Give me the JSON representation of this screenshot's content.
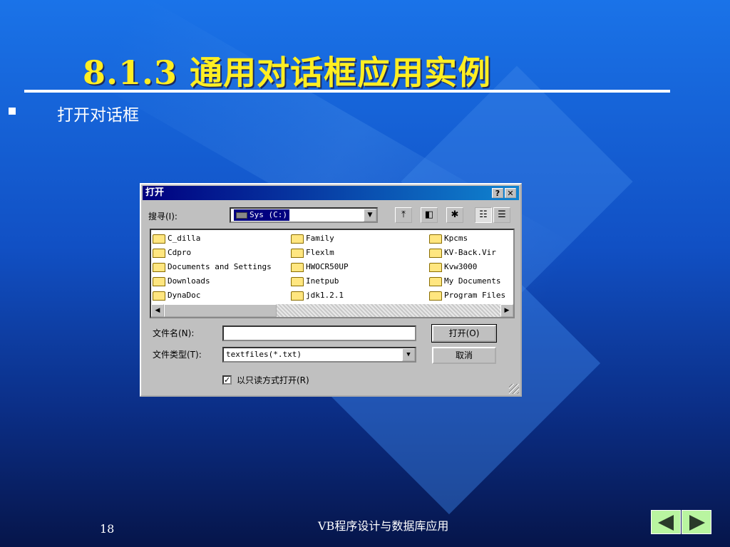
{
  "slide": {
    "title": "8.1.3  通用对话框应用实例",
    "bullet": "打开对话框",
    "page_number": "18",
    "footer": "VB程序设计与数据库应用"
  },
  "dialog": {
    "title": "打开",
    "help_label": "?",
    "close_label": "✕",
    "lookin_label": "搜寻(I):",
    "lookin_value": "Sys (C:)",
    "files": [
      [
        "C_dilla",
        "Cdpro",
        "Documents and Settings",
        "Downloads",
        "DynaDoc"
      ],
      [
        "Family",
        "Flexlm",
        "HWOCR50UP",
        "Inetpub",
        "jdk1.2.1"
      ],
      [
        "Kpcms",
        "KV-Back.Vir",
        "Kvw3000",
        "My Documents",
        "Program Files"
      ]
    ],
    "filename_label": "文件名(N):",
    "filename_value": "",
    "filetype_label": "文件类型(T):",
    "filetype_value": "textfiles(*.txt)",
    "open_button": "打开(O)",
    "cancel_button": "取消",
    "readonly_label": "以只读方式打开(R)",
    "readonly_checked": true
  },
  "colors": {
    "title": "#ffee22",
    "nav_button": "#b9f5a0"
  }
}
